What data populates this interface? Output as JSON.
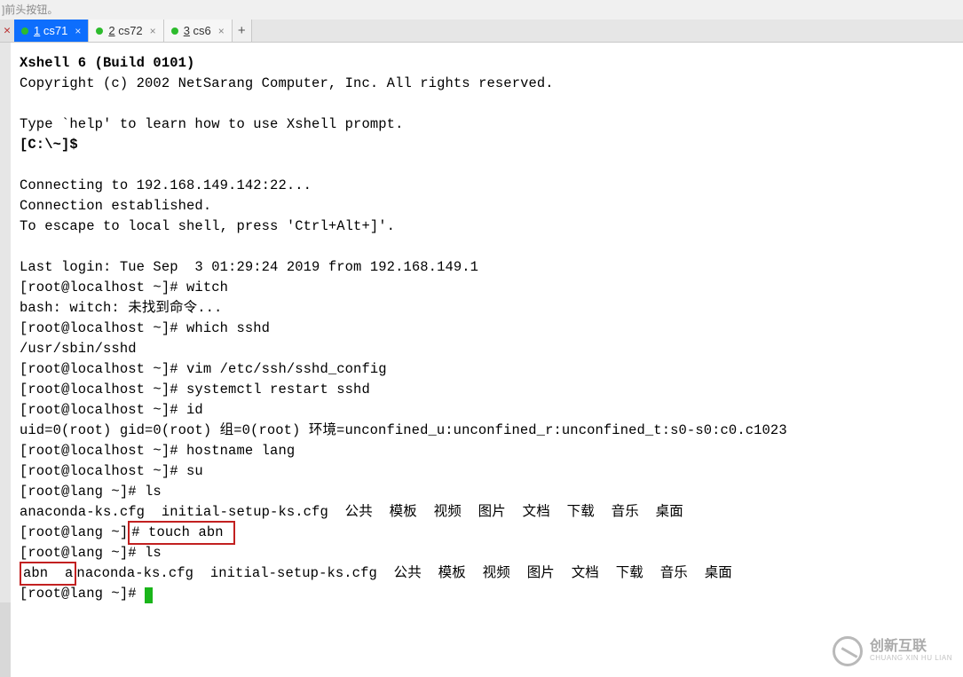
{
  "hint": "]前头按钮。",
  "tabs": {
    "items": [
      {
        "num": "1",
        "name": "cs71",
        "active": true
      },
      {
        "num": "2",
        "name": "cs72",
        "active": false
      },
      {
        "num": "3",
        "name": "cs6",
        "active": false
      }
    ],
    "close_glyph": "×",
    "new_glyph": "+"
  },
  "term": {
    "banner1": "Xshell 6 (Build 0101)",
    "banner2": "Copyright (c) 2002 NetSarang Computer, Inc. All rights reserved.",
    "hint": "Type `help' to learn how to use Xshell prompt.",
    "local_prompt": "[C:\\~]$",
    "connect1": "Connecting to 192.168.149.142:22...",
    "connect2": "Connection established.",
    "connect3": "To escape to local shell, press 'Ctrl+Alt+]'.",
    "lastlogin": "Last login: Tue Sep  3 01:29:24 2019 from 192.168.149.1",
    "p1": "[root@localhost ~]# ",
    "cmd_witch": "witch",
    "witch_err": "bash: witch: 未找到命令...",
    "cmd_which": "which sshd",
    "which_out": "/usr/sbin/sshd",
    "cmd_vim": "vim /etc/ssh/sshd_config",
    "cmd_restart": "systemctl restart sshd",
    "cmd_id": "id",
    "id_out": "uid=0(root) gid=0(root) 组=0(root) 环境=unconfined_u:unconfined_r:unconfined_t:s0-s0:c0.c1023",
    "cmd_hostname": "hostname lang",
    "cmd_su": "su",
    "p2": "[root@lang ~]# ",
    "cmd_ls": "ls",
    "ls_out1": "anaconda-ks.cfg  initial-setup-ks.cfg  公共  模板  视频  图片  文档  下载  音乐  桌面",
    "touch_part1": "# touch abn ",
    "touch_prefix": "[root@lang ~]",
    "ls_out2_a": "abn  a",
    "ls_out2_b": "naconda-ks.cfg  initial-setup-ks.cfg  公共  模板  视频  图片  文档  下载  音乐  桌面"
  },
  "watermark": {
    "cn": "创新互联",
    "en": "CHUANG XIN HU LIAN"
  }
}
